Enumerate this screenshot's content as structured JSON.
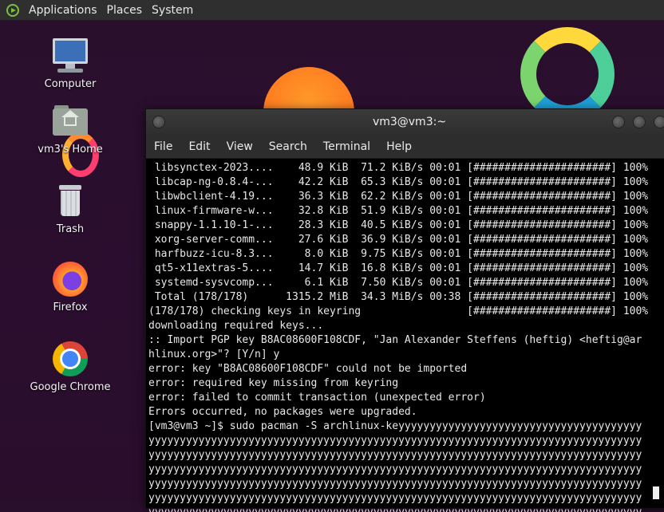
{
  "panel": {
    "menus": [
      "Applications",
      "Places",
      "System"
    ]
  },
  "desktop": {
    "icons": [
      {
        "label": "Computer",
        "icon": "computer-icon"
      },
      {
        "label": "vm3's Home",
        "icon": "home-folder-icon"
      },
      {
        "label": "Trash",
        "icon": "trash-icon"
      },
      {
        "label": "Firefox",
        "icon": "firefox-icon"
      },
      {
        "label": "Google Chrome",
        "icon": "chrome-icon"
      }
    ]
  },
  "terminal": {
    "title": "vm3@vm3:~",
    "menu": [
      "File",
      "Edit",
      "View",
      "Search",
      "Terminal",
      "Help"
    ],
    "lines": [
      " libsynctex-2023....    48.9 KiB  71.2 KiB/s 00:01 [######################] 100%",
      " libcap-ng-0.8.4-...    42.2 KiB  65.3 KiB/s 00:01 [######################] 100%",
      " libwbclient-4.19...    36.3 KiB  62.2 KiB/s 00:01 [######################] 100%",
      " linux-firmware-w...    32.8 KiB  51.9 KiB/s 00:01 [######################] 100%",
      " snappy-1.1.10-1-...    28.3 KiB  40.5 KiB/s 00:01 [######################] 100%",
      " xorg-server-comm...    27.6 KiB  36.9 KiB/s 00:01 [######################] 100%",
      " harfbuzz-icu-8.3...     8.0 KiB  9.75 KiB/s 00:01 [######################] 100%",
      " qt5-x11extras-5....    14.7 KiB  16.8 KiB/s 00:01 [######################] 100%",
      " systemd-sysvcomp...     6.1 KiB  7.50 KiB/s 00:01 [######################] 100%",
      " Total (178/178)      1315.2 MiB  34.3 MiB/s 00:38 [######################] 100%",
      "(178/178) checking keys in keyring                 [######################] 100%",
      "downloading required keys...",
      ":: Import PGP key B8AC08600F108CDF, \"Jan Alexander Steffens (heftig) <heftig@ar",
      "hlinux.org>\"? [Y/n] y",
      "error: key \"B8AC08600F108CDF\" could not be imported",
      "error: required key missing from keyring",
      "error: failed to commit transaction (unexpected error)",
      "Errors occurred, no packages were upgraded.",
      "[vm3@vm3 ~]$ sudo pacman -S archlinux-keyyyyyyyyyyyyyyyyyyyyyyyyyyyyyyyyyyyyyyy",
      "yyyyyyyyyyyyyyyyyyyyyyyyyyyyyyyyyyyyyyyyyyyyyyyyyyyyyyyyyyyyyyyyyyyyyyyyyyyyyyy",
      "yyyyyyyyyyyyyyyyyyyyyyyyyyyyyyyyyyyyyyyyyyyyyyyyyyyyyyyyyyyyyyyyyyyyyyyyyyyyyyy",
      "yyyyyyyyyyyyyyyyyyyyyyyyyyyyyyyyyyyyyyyyyyyyyyyyyyyyyyyyyyyyyyyyyyyyyyyyyyyyyyy",
      "yyyyyyyyyyyyyyyyyyyyyyyyyyyyyyyyyyyyyyyyyyyyyyyyyyyyyyyyyyyyyyyyyyyyyyyyyyyyyyy",
      "yyyyyyyyyyyyyyyyyyyyyyyyyyyyyyyyyyyyyyyyyyyyyyyyyyyyyyyyyyyyyyyyyyyyyyyyyyyyyyy",
      "yyyyyyyyyyyyyyyyyyyyyyyyyyyyyyyyyyyyyyyyyyyyyyyyyyyyyyyyyyyyyyyyyyyyyyyyyyyyyyy"
    ]
  }
}
